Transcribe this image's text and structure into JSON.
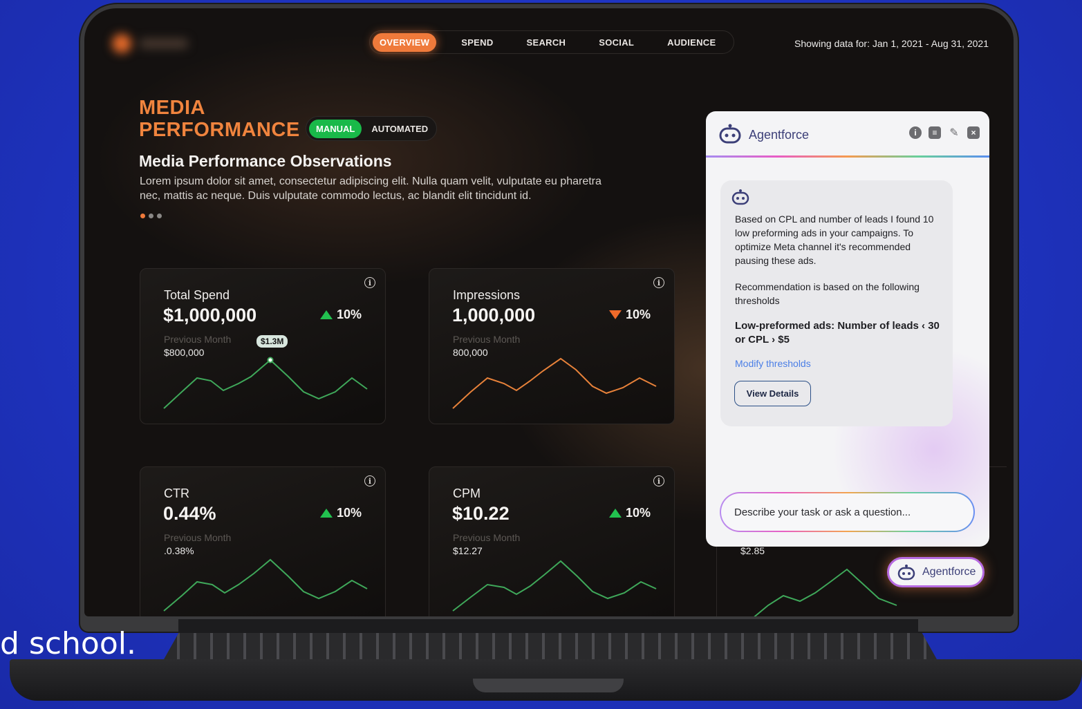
{
  "nav": {
    "tabs": [
      {
        "label": "OVERVIEW",
        "active": true
      },
      {
        "label": "SPEND",
        "active": false
      },
      {
        "label": "SEARCH",
        "active": false
      },
      {
        "label": "SOCIAL",
        "active": false
      },
      {
        "label": "AUDIENCE",
        "active": false
      }
    ],
    "date_range": "Showing data for: Jan 1, 2021 - Aug 31, 2021"
  },
  "header": {
    "title_line1": "MEDIA",
    "title_line2": "PERFORMANCE",
    "toggle": {
      "manual": "MANUAL",
      "automated": "AUTOMATED",
      "selected": "MANUAL"
    }
  },
  "observations": {
    "title": "Media Performance Observations",
    "text": "Lorem ipsum dolor sit amet, consectetur adipiscing elit. Nulla quam velit, vulputate eu pharetra nec, mattis ac neque. Duis vulputate commodo lectus, ac blandit elit tincidunt id.",
    "carousel_dots": 3,
    "active_dot": 0
  },
  "metrics": [
    {
      "label": "Total Spend",
      "value": "$1,000,000",
      "delta": "10%",
      "direction": "up",
      "prev_label": "Previous Month",
      "prev_value": "$800,000",
      "tooltip": "$1.3M",
      "line_color": "#3fa85a"
    },
    {
      "label": "Impressions",
      "value": "1,000,000",
      "delta": "10%",
      "direction": "down",
      "prev_label": "Previous Month",
      "prev_value": "800,000",
      "line_color": "#e8823a"
    },
    {
      "label": "CTR",
      "value": "0.44%",
      "delta": "10%",
      "direction": "up",
      "prev_label": "Previous Month",
      "prev_value": ".0.38%",
      "line_color": "#3fa85a"
    },
    {
      "label": "CPM",
      "value": "$10.22",
      "delta": "10%",
      "direction": "up",
      "prev_label": "Previous Month",
      "prev_value": "$12.27",
      "line_color": "#3fa85a"
    }
  ],
  "partial_card_value": "$2.85",
  "agentforce": {
    "title": "Agentforce",
    "message1": "Based on CPL and number of leads I found 10 low preforming ads in your campaigns. To optimize Meta channel it's recommended pausing these ads.",
    "message2": "Recommendation is based on the following thresholds",
    "threshold": "Low-preformed ads: Number of leads ‹ 30 or CPL › $5",
    "modify_link": "Modify thresholds",
    "details_button": "View Details",
    "input_placeholder": "Describe your task or ask a question...",
    "fab_label": "Agentforce",
    "icons": [
      "info-icon",
      "chat-icon",
      "pin-icon",
      "close-icon"
    ]
  },
  "caption": "d school.",
  "colors": {
    "accent": "#ef7a3b",
    "toggle_active": "#19b949",
    "up": "#22c14f",
    "down": "#f06a2a",
    "background": "#1f35c4"
  }
}
